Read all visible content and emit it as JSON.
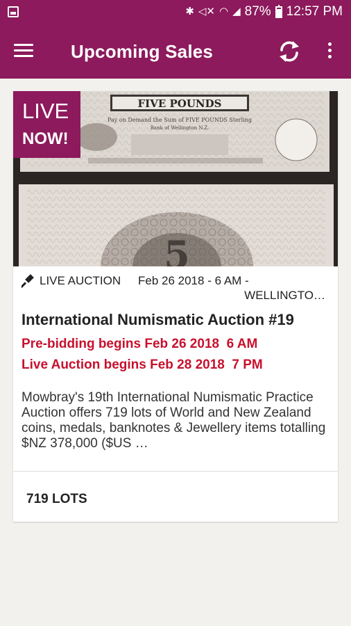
{
  "status_bar": {
    "battery_percent": "87%",
    "time": "12:57 PM",
    "icons": [
      "gallery-icon",
      "bluetooth-icon",
      "mute-icon",
      "wifi-icon",
      "signal-icon",
      "battery-icon"
    ]
  },
  "app_bar": {
    "title": "Upcoming Sales",
    "icons": [
      "menu-icon",
      "refresh-icon",
      "more-vertical-icon"
    ]
  },
  "colors": {
    "brand": "#8c1a5c",
    "alert_red": "#c8102e",
    "background": "#f2f1ee"
  },
  "sale": {
    "badge_live": "LIVE",
    "badge_now": "NOW!",
    "type": "LIVE AUCTION",
    "date": "Feb 26 2018 - 6 AM -",
    "location": "WELLINGTO…",
    "title": "International Numismatic Auction #19",
    "prebid": "Pre-bidding begins Feb 26 2018  6 AM",
    "live": "Live Auction begins Feb 28 2018  7 PM",
    "description": "Mowbray's 19th International Numismatic Practice Auction offers 719 lots of World and New Zealand coins, medals, banknotes & Jewellery items totalling $NZ 378,000 ($US …",
    "lots": "719 LOTS",
    "banknote_heading": "FIVE POUNDS",
    "banknote_line": "Pay on Demand the Sum of FIVE POUNDS Sterling",
    "banknote_city": "Bank of Wellington N.Z."
  }
}
